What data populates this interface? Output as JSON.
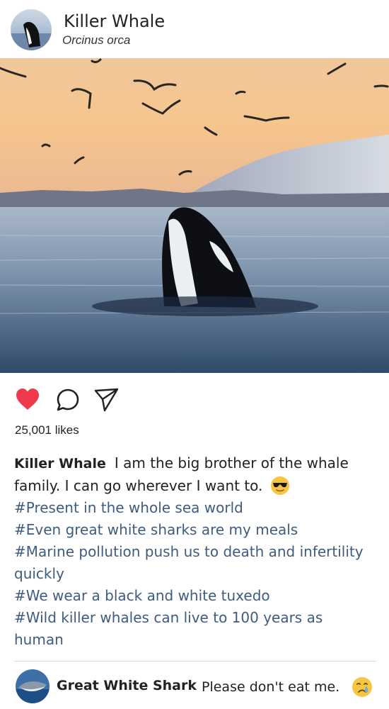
{
  "post": {
    "author": "Killer Whale",
    "subtitle": "Orcinus orca",
    "likes": "25,001 likes",
    "caption_user": "Killer Whale",
    "caption_text": "I am the big brother of the whale family. I can go wherever I want to.",
    "caption_emoji": "sunglasses-emoji",
    "hashtags": [
      "#Present in the whole sea world",
      "#Even great white sharks are my meals",
      "#Marine pollution push us to death and infertility quickly",
      "#We wear a black and white tuxedo",
      "#Wild killer whales can live to 100 years as human"
    ]
  },
  "actions": {
    "like_icon": "heart-icon",
    "comment_icon": "comment-icon",
    "share_icon": "send-icon",
    "like_color": "#ee3a4c"
  },
  "comment": {
    "user": "Great White Shark",
    "text": "Please don't eat me.",
    "emoji": "crying-emoji"
  },
  "colors": {
    "hashtag": "#3d5c7e",
    "text": "#222222"
  }
}
